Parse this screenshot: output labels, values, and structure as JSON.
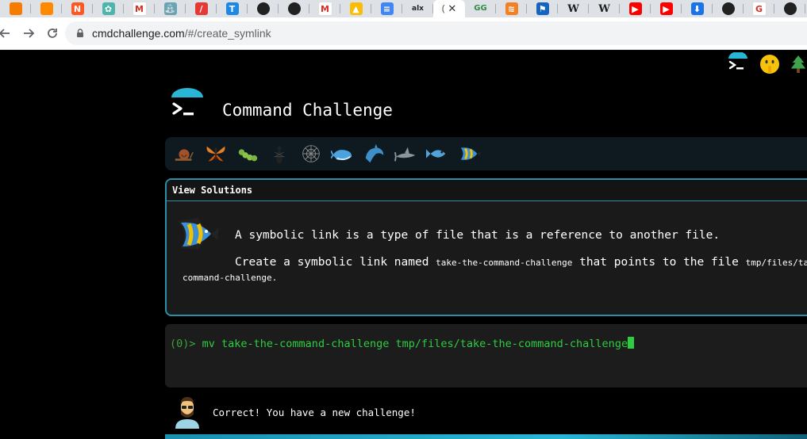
{
  "browser": {
    "tabs": [
      {
        "icon": "orange-tab-icon",
        "color": "#f57c00",
        "glyph": ""
      },
      {
        "icon": "orange-cube-icon",
        "color": "#ff8a00",
        "glyph": ""
      },
      {
        "icon": "zigzag-icon",
        "color": "#ff5722",
        "glyph": "N"
      },
      {
        "icon": "colorful-logo-icon",
        "color": "#4db6ac",
        "glyph": "✿"
      },
      {
        "icon": "gmail-icon",
        "color": "#ffffff",
        "glyph": "M"
      },
      {
        "icon": "fountain-icon",
        "color": "#6aa3b4",
        "glyph": "⛲"
      },
      {
        "icon": "red-slash-icon",
        "color": "#e53935",
        "glyph": "/"
      },
      {
        "icon": "t-logo-icon",
        "color": "#1e88e5",
        "glyph": "T"
      },
      {
        "icon": "github-icon",
        "color": "#222222",
        "glyph": "●"
      },
      {
        "icon": "github-icon",
        "color": "#222222",
        "glyph": "●"
      },
      {
        "icon": "gmail-icon",
        "color": "#ffffff",
        "glyph": "M"
      },
      {
        "icon": "google-drive-icon",
        "color": "#fbbc04",
        "glyph": "▲"
      },
      {
        "icon": "google-docs-icon",
        "color": "#4285f4",
        "glyph": "≡"
      },
      {
        "icon": "alx-icon",
        "color": "transparent",
        "glyph": "alx"
      },
      {
        "icon": "cmdchallenge-tab-icon",
        "color": "transparent",
        "glyph": "",
        "active": true
      },
      {
        "icon": "geeksforgeeks-icon",
        "color": "transparent",
        "glyph": "GG"
      },
      {
        "icon": "stackoverflow-icon",
        "color": "#f48024",
        "glyph": "≋"
      },
      {
        "icon": "blue-bookmark-icon",
        "color": "#1565c0",
        "glyph": "⚑"
      },
      {
        "icon": "wikipedia-icon",
        "color": "transparent",
        "glyph": "W"
      },
      {
        "icon": "wikipedia-icon",
        "color": "transparent",
        "glyph": "W"
      },
      {
        "icon": "youtube-icon",
        "color": "#ff0000",
        "glyph": "▶"
      },
      {
        "icon": "youtube-icon",
        "color": "#ff0000",
        "glyph": "▶"
      },
      {
        "icon": "download-icon",
        "color": "#1a73e8",
        "glyph": "⬇"
      },
      {
        "icon": "github-icon",
        "color": "#222222",
        "glyph": "●"
      },
      {
        "icon": "google-icon",
        "color": "#ffffff",
        "glyph": "G"
      },
      {
        "icon": "github-icon",
        "color": "#222222",
        "glyph": "●"
      },
      {
        "icon": "github-icon",
        "color": "#222222",
        "glyph": "●"
      }
    ],
    "active_tab_glyph": "(",
    "url_host": "cmdchallenge.com",
    "url_path": "/#/create_symlink"
  },
  "header": {
    "title": "Command Challenge"
  },
  "levels": [
    "snail-icon",
    "butterfly-icon",
    "caterpillar-icon",
    "ant-icon",
    "spider-web-icon",
    "whale-icon",
    "dolphin-icon",
    "shark-icon",
    "fish-icon",
    "tropical-fish-icon"
  ],
  "challenge": {
    "solutions_label": "View Solutions",
    "line1": "A symbolic link is a type of file that is a reference to another file.",
    "line2_pre": "Create a symbolic link named ",
    "line2_code1": "take-the-command-challenge",
    "line2_mid": " that points to the file ",
    "line2_code2": "tmp/files/ta",
    "line3": "command-challenge."
  },
  "terminal": {
    "prompt": "(0)> ",
    "command": "mv take-the-command-challenge tmp/files/take-the-command-challenge"
  },
  "feedback": {
    "message": "Correct! You have a new challenge!"
  },
  "colors": {
    "accent": "#29b6d6",
    "terminal_green": "#2ecc40"
  }
}
